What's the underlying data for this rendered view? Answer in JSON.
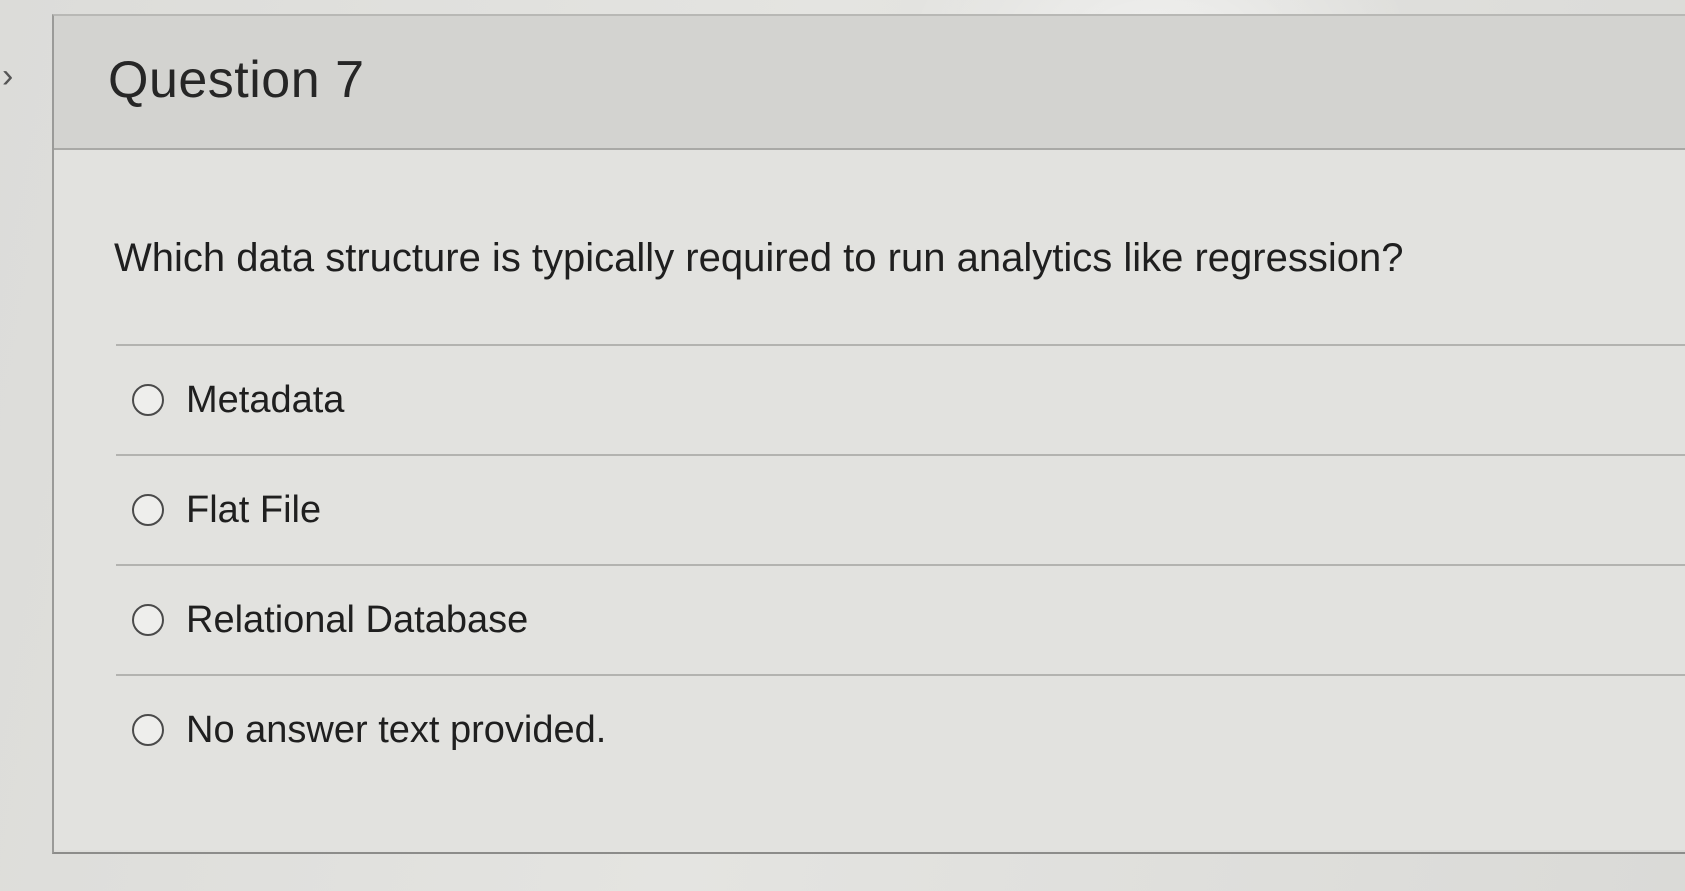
{
  "question": {
    "title": "Question 7",
    "text": "Which data structure is typically required to run analytics like regression?",
    "answers": [
      {
        "label": "Metadata",
        "selected": false
      },
      {
        "label": "Flat File",
        "selected": false
      },
      {
        "label": "Relational Database",
        "selected": false
      },
      {
        "label": "No answer text provided.",
        "selected": false
      }
    ]
  },
  "icons": {
    "nav": "chevron-right-icon",
    "answer": "radio-button-icon"
  },
  "colors": {
    "header_background": "#d3d3d0",
    "body_background": "#e2e2df",
    "text": "#1f1f1f"
  }
}
